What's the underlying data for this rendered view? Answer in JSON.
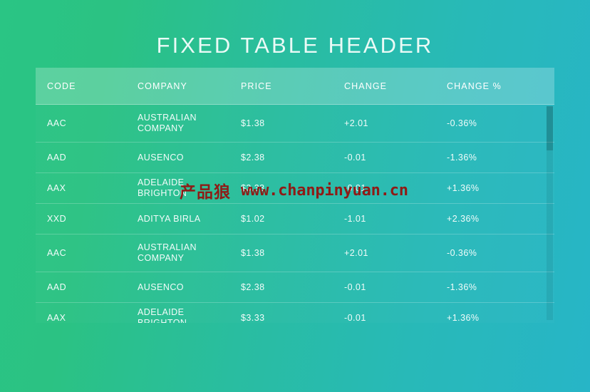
{
  "page": {
    "title": "FIXED TABLE HEADER",
    "background_from": "#2ac584",
    "background_to": "#27b5c7"
  },
  "table": {
    "columns": [
      {
        "key": "code",
        "label": "CODE"
      },
      {
        "key": "company",
        "label": "COMPANY"
      },
      {
        "key": "price",
        "label": "PRICE"
      },
      {
        "key": "change",
        "label": "CHANGE"
      },
      {
        "key": "pct",
        "label": "CHANGE %"
      }
    ],
    "rows": [
      {
        "code": "AAC",
        "company": "AUSTRALIAN\nCOMPANY",
        "price": "$1.38",
        "change": "+2.01",
        "pct": "-0.36%"
      },
      {
        "code": "AAD",
        "company": "AUSENCO",
        "price": "$2.38",
        "change": "-0.01",
        "pct": "-1.36%"
      },
      {
        "code": "AAX",
        "company": "ADELAIDE BRIGHTON",
        "price": "$3.33",
        "change": "-0.01",
        "pct": "+1.36%"
      },
      {
        "code": "XXD",
        "company": "ADITYA BIRLA",
        "price": "$1.02",
        "change": "-1.01",
        "pct": "+2.36%"
      },
      {
        "code": "AAC",
        "company": "AUSTRALIAN\nCOMPANY",
        "price": "$1.38",
        "change": "+2.01",
        "pct": "-0.36%"
      },
      {
        "code": "AAD",
        "company": "AUSENCO",
        "price": "$2.38",
        "change": "-0.01",
        "pct": "-1.36%"
      },
      {
        "code": "AAX",
        "company": "ADELAIDE BRIGHTON",
        "price": "$3.33",
        "change": "-0.01",
        "pct": "+1.36%"
      }
    ]
  },
  "watermark": {
    "brand": "产品狼",
    "url": "www.chanpinyuan.cn",
    "color": "#8e1b16"
  }
}
